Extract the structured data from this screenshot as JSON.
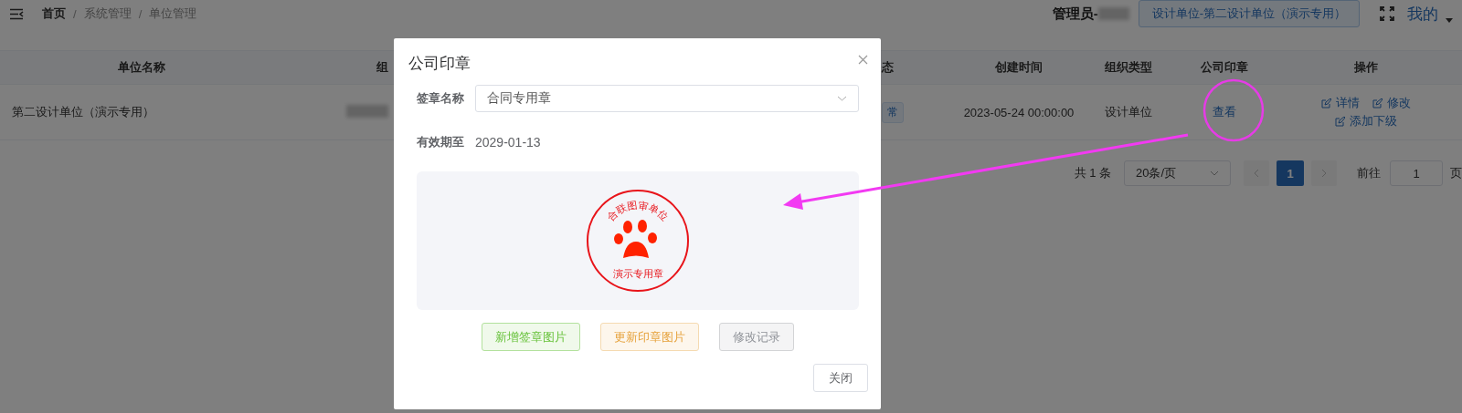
{
  "header": {
    "breadcrumb_separator": "/",
    "breadcrumb": [
      {
        "label": "首页",
        "current": true
      },
      {
        "label": "系统管理",
        "current": false
      },
      {
        "label": "单位管理",
        "current": false
      }
    ],
    "user_label": "管理员-",
    "org_button": "设计单位-第二设计单位（演示专用）",
    "menu_label": "我的"
  },
  "table": {
    "columns": [
      "单位名称",
      "组",
      "态",
      "创建时间",
      "组织类型",
      "公司印章",
      "操作"
    ],
    "rows": [
      {
        "name": "第二设计单位（演示专用）",
        "status": "常",
        "created": "2023-05-24 00:00:00",
        "org_type": "设计单位",
        "seal_link": "查看",
        "actions": [
          "详情",
          "修改",
          "添加下级"
        ]
      }
    ]
  },
  "pagination": {
    "total": "共 1 条",
    "page_size": "20条/页",
    "pages": [
      {
        "label": "1",
        "selected": true
      }
    ],
    "goto_label": "前往",
    "goto_value": "1",
    "goto_suffix": "页"
  },
  "dialog": {
    "title": "公司印章",
    "fields": [
      {
        "kind": "select",
        "label": "签章名称",
        "value": "合同专用章"
      },
      {
        "kind": "text",
        "label": "有效期至",
        "value": "2029-01-13"
      }
    ],
    "stamp": {
      "arc_text": "合联图审单位",
      "bottom_text": "演示专用章"
    },
    "buttons": [
      {
        "label": "新增签章图片",
        "kind": "success"
      },
      {
        "label": "更新印章图片",
        "kind": "warning"
      },
      {
        "label": "修改记录",
        "kind": "info"
      }
    ],
    "footer_button": "关闭"
  }
}
